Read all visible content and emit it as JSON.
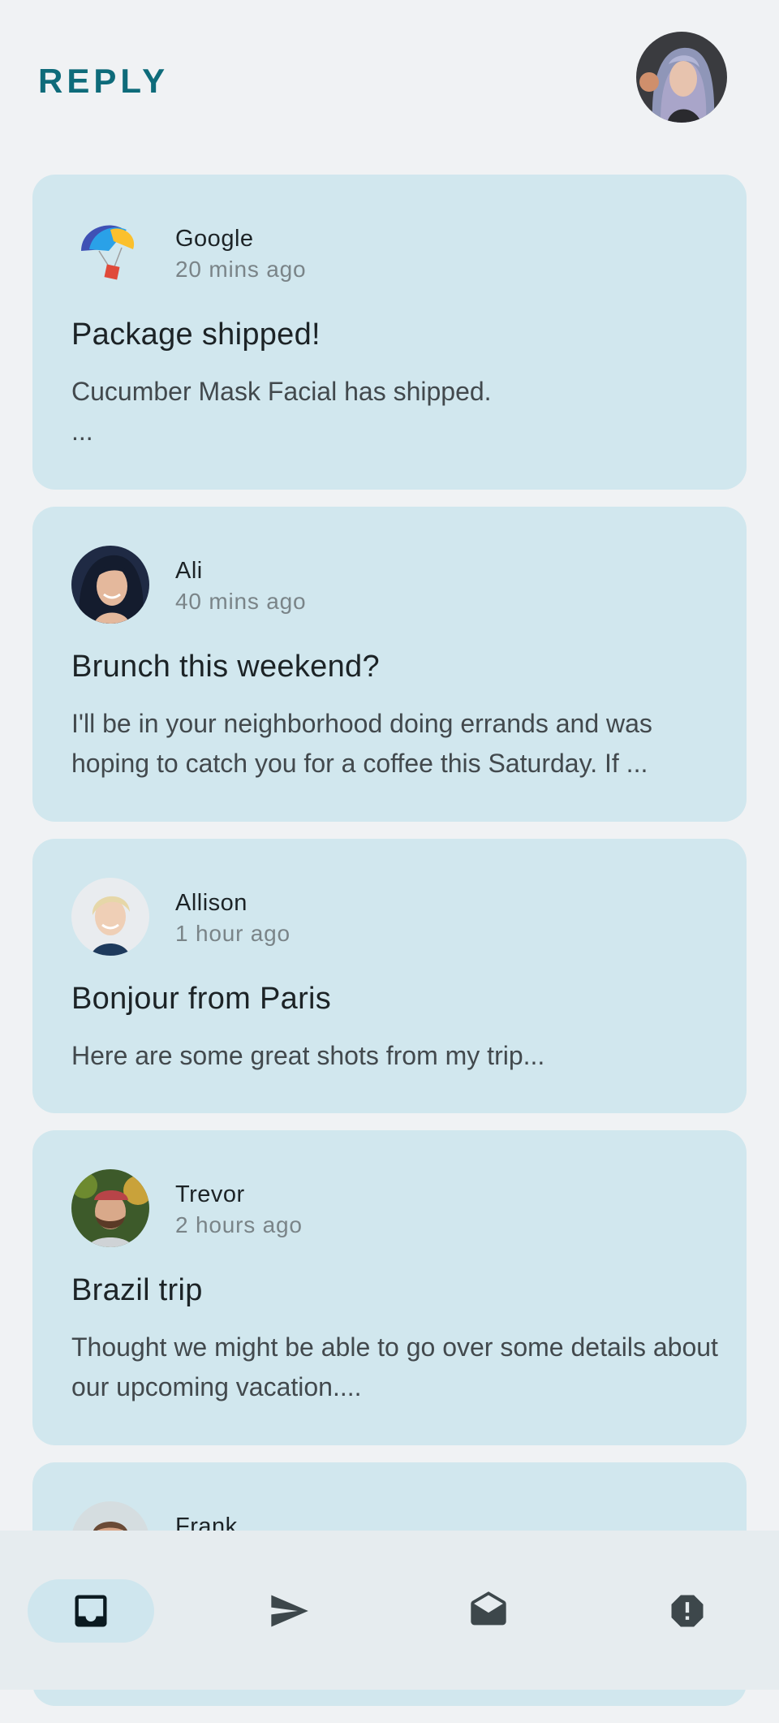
{
  "app": {
    "logo_text": "REPLY"
  },
  "emails": [
    {
      "sender": "Google",
      "time": "20 mins ago",
      "subject": "Package shipped!",
      "preview": "Cucumber Mask Facial has shipped.\n..."
    },
    {
      "sender": "Ali",
      "time": "40 mins ago",
      "subject": "Brunch this weekend?",
      "preview": "I'll be in your neighborhood doing errands and was hoping to catch you for a coffee this Saturday. If ..."
    },
    {
      "sender": "Allison",
      "time": "1 hour ago",
      "subject": "Bonjour from Paris",
      "preview": "Here are some great shots from my trip..."
    },
    {
      "sender": "Trevor",
      "time": "2 hours ago",
      "subject": "Brazil trip",
      "preview": "Thought we might be able to go over some details about our upcoming vacation...."
    },
    {
      "sender": "Frank",
      "time": "",
      "subject": "",
      "preview": ""
    }
  ],
  "bottom_nav": {
    "items": [
      {
        "icon": "inbox-icon",
        "active": true
      },
      {
        "icon": "send-icon",
        "active": false
      },
      {
        "icon": "drafts-icon",
        "active": false
      },
      {
        "icon": "spam-icon",
        "active": false
      }
    ]
  },
  "colors": {
    "accent": "#0e6b7a",
    "card_background": "#d1e7ee",
    "page_background": "#f0f2f4",
    "nav_background": "#e6ecef",
    "active_nav_pill": "#cfe6ee"
  }
}
